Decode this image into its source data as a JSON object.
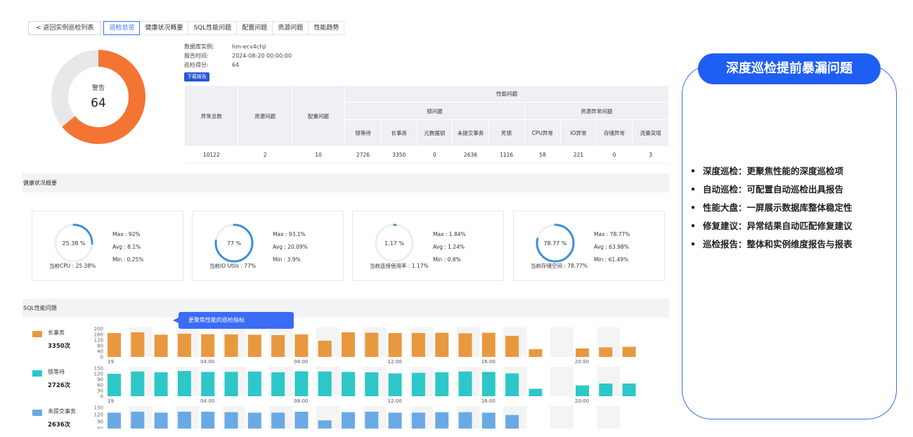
{
  "tabs": {
    "back": "返回实例巡检列表",
    "items": [
      "巡检总览",
      "健康状况概要",
      "SQL性能问题",
      "配置问题",
      "资源问题",
      "性能趋势"
    ],
    "active": 0
  },
  "overview": {
    "gauge": {
      "label": "警告",
      "score": "64",
      "score_value": 64,
      "color": "#f47434",
      "track": "#e8e8e8"
    },
    "info": [
      {
        "k": "数据库实例:",
        "v": "hm-ecv4chji"
      },
      {
        "k": "报告时间:",
        "v": "2024-08-20 00:00:00"
      },
      {
        "k": "巡检得分:",
        "v": "64"
      }
    ],
    "download": "下载报告",
    "table": {
      "h_total": "异常总数",
      "h_resource": "资源问题",
      "h_config": "配置问题",
      "h_perf": "性能问题",
      "h_lock": "锁问题",
      "h_resexc": "资源异常问题",
      "sub_headers": [
        "锁等待",
        "长事务",
        "元数据锁",
        "未提交事务",
        "死锁",
        "CPU异常",
        "IO异常",
        "存储异常",
        "流量突增"
      ],
      "values": [
        "10122",
        "2",
        "10",
        "2726",
        "3350",
        "0",
        "2636",
        "1116",
        "58",
        "221",
        "0",
        "3"
      ]
    }
  },
  "health": {
    "title": "健康状况概要",
    "cards": [
      {
        "center": "25.38 %",
        "percent": 25.38,
        "current": "当前CPU : 25.38%",
        "max": "Max :  92%",
        "avg": "Avg :  8.1%",
        "min": "Min :  0.25%",
        "color": "#3d8fdc"
      },
      {
        "center": "77 %",
        "percent": 77,
        "current": "当前IO Utils : 77%",
        "max": "Max :  93.1%",
        "avg": "Avg :  20.09%",
        "min": "Min :  3.9%",
        "color": "#3d8fdc",
        "color2": "#5fc99a"
      },
      {
        "center": "1.17 %",
        "percent": 1.17,
        "current": "当前连接使用率 : 1.17%",
        "max": "Max :  1.84%",
        "avg": "Avg :  1.24%",
        "min": "Min :  0.8%",
        "color": "#3d8fdc"
      },
      {
        "center": "78.77 %",
        "percent": 78.77,
        "current": "当前存储空间 : 78.77%",
        "max": "Max :  78.77%",
        "avg": "Avg :  63.98%",
        "min": "Min :  61.49%",
        "color": "#3d8fdc",
        "color2": "#5fc99a"
      }
    ]
  },
  "sql": {
    "title": "SQL性能问题",
    "tooltip": "更聚焦性能的巡检指标",
    "x_ticks": [
      "19",
      "04:00",
      "08:00",
      "12:00",
      "16:00",
      "20:00"
    ],
    "series": [
      {
        "name": "长事务",
        "count": "3350次",
        "color": "#e8993f",
        "yticks": [
          "200",
          "160",
          "120",
          "80",
          "40",
          "0"
        ],
        "ymax": 200,
        "values": [
          170,
          175,
          158,
          165,
          162,
          160,
          158,
          155,
          160,
          115,
          175,
          172,
          170,
          170,
          172,
          168,
          172,
          150,
          55,
          null,
          60,
          68,
          72
        ]
      },
      {
        "name": "锁等待",
        "count": "2726次",
        "color": "#2ec7c9",
        "yticks": [
          "150",
          "120",
          "90",
          "60",
          "30",
          "0"
        ],
        "ymax": 150,
        "values": [
          120,
          132,
          128,
          135,
          130,
          130,
          132,
          128,
          133,
          132,
          130,
          128,
          122,
          125,
          128,
          132,
          130,
          122,
          40,
          null,
          58,
          68,
          68
        ]
      },
      {
        "name": "未提交事务",
        "count": "2636次",
        "color": "#6aaae4",
        "yticks": [
          "150",
          "120",
          "90",
          "60"
        ],
        "ymax": 150,
        "values": [
          128,
          132,
          128,
          132,
          132,
          130,
          128,
          128,
          132,
          95,
          130,
          132,
          128,
          128,
          130,
          130,
          128,
          118,
          null,
          null,
          42,
          48,
          50
        ]
      }
    ]
  },
  "callout": {
    "title": "深度巡检提前暴漏问题",
    "features": [
      "深度巡检：更聚焦性能的深度巡检项",
      "自动巡检：可配置自动巡检出具报告",
      "性能大盘：一屏展示数据库整体稳定性",
      "修复建议：异常结果自动匹配修复建议",
      "巡检报告：整体和实例维度报告与报表"
    ]
  }
}
